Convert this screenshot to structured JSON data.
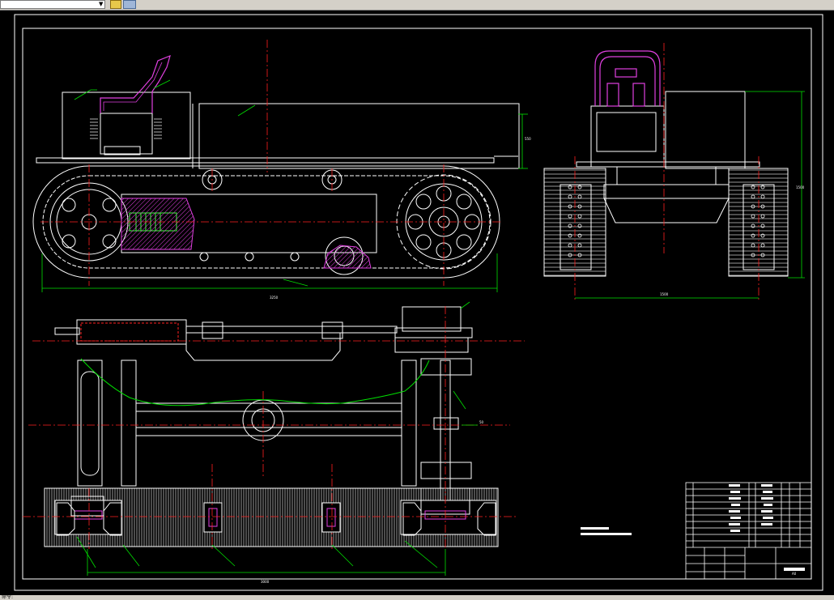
{
  "toolbar": {
    "field_value": "",
    "dropdown_icon": "chevron-down-icon",
    "tool_icon_1": "layer-icon",
    "tool_icon_2": "properties-icon"
  },
  "status": {
    "command_text": "命令:"
  },
  "colors": {
    "background": "#000000",
    "lines": "#ffffff",
    "centerlines": "#ff2020",
    "dimensions": "#00e000",
    "seat": "#e040e0",
    "spring": "#40ff40"
  },
  "drawing": {
    "dims": {
      "track_length": "3250",
      "side_height": "550",
      "front_height": "1500",
      "front_width": "1500",
      "plan_length": "3000",
      "plan_offset": "50"
    },
    "note": {
      "line1": "",
      "line2": ""
    },
    "title_block": {
      "material": "",
      "scale": "A0"
    }
  }
}
